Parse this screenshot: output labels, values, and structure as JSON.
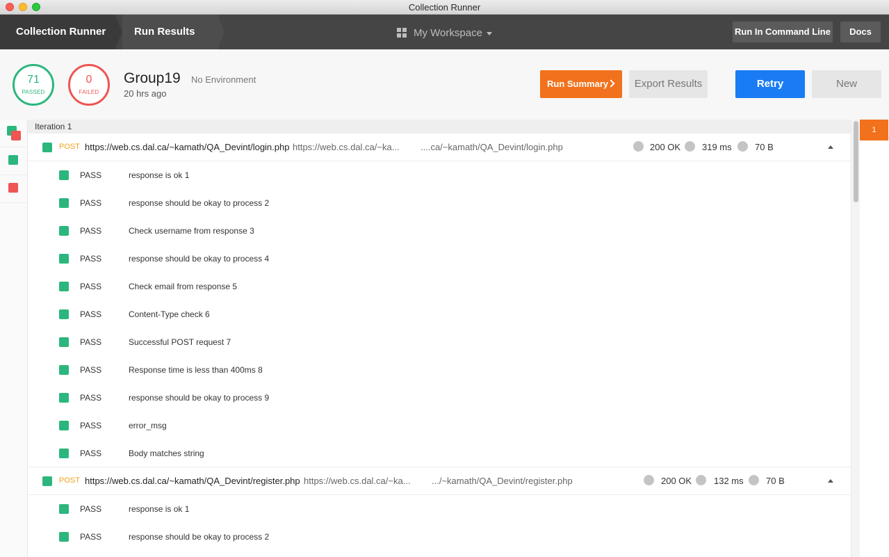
{
  "window": {
    "title": "Collection Runner"
  },
  "nav": {
    "crumb_runner": "Collection Runner",
    "crumb_results": "Run Results",
    "workspace": "My Workspace",
    "cli_button": "Run In Command Line",
    "docs_button": "Docs"
  },
  "summary": {
    "passed_count": "71",
    "passed_label": "PASSED",
    "failed_count": "0",
    "failed_label": "FAILED",
    "name": "Group19",
    "environment": "No Environment",
    "time": "20 hrs ago",
    "run_summary_button": "Run Summary",
    "export_button": "Export Results",
    "retry_button": "Retry",
    "new_button": "New"
  },
  "iteration": {
    "label": "Iteration 1",
    "badge": "1"
  },
  "requests": [
    {
      "method": "POST",
      "url": "https://web.cs.dal.ca/~kamath/QA_Devint/login.php",
      "url_short": "https://web.cs.dal.ca/~ka...",
      "url_tail": "....ca/~kamath/QA_Devint/login.php",
      "status": "200 OK",
      "time": "319 ms",
      "size": "70 B",
      "tests": [
        {
          "result": "PASS",
          "name": "response is ok 1"
        },
        {
          "result": "PASS",
          "name": "response should be okay to process 2"
        },
        {
          "result": "PASS",
          "name": "Check username from response 3"
        },
        {
          "result": "PASS",
          "name": "response should be okay to process 4"
        },
        {
          "result": "PASS",
          "name": "Check email from response 5"
        },
        {
          "result": "PASS",
          "name": "Content-Type check 6"
        },
        {
          "result": "PASS",
          "name": "Successful POST request 7"
        },
        {
          "result": "PASS",
          "name": "Response time is less than 400ms 8"
        },
        {
          "result": "PASS",
          "name": "response should be okay to process 9"
        },
        {
          "result": "PASS",
          "name": "error_msg"
        },
        {
          "result": "PASS",
          "name": "Body matches string"
        }
      ]
    },
    {
      "method": "POST",
      "url": "https://web.cs.dal.ca/~kamath/QA_Devint/register.php",
      "url_short": "https://web.cs.dal.ca/~ka...",
      "url_tail": ".../~kamath/QA_Devint/register.php",
      "status": "200 OK",
      "time": "132 ms",
      "size": "70 B",
      "tests": [
        {
          "result": "PASS",
          "name": "response is ok 1"
        },
        {
          "result": "PASS",
          "name": "response should be okay to process 2"
        }
      ]
    }
  ],
  "colors": {
    "pass": "#2cb67d",
    "fail": "#ee5553",
    "accent": "#f2711c",
    "primary": "#1a7cf4"
  }
}
